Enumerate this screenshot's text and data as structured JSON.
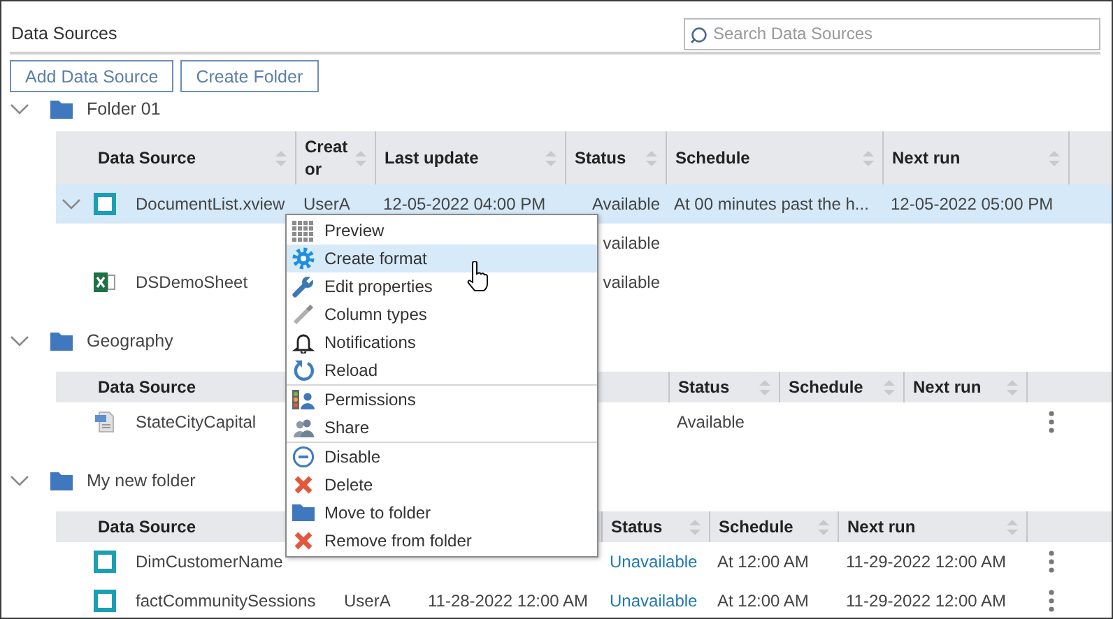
{
  "header": {
    "title": "Data Sources",
    "search": {
      "placeholder": "Search Data Sources"
    }
  },
  "toolbar": [
    "Add Data Source",
    "Create Folder"
  ],
  "folders": [
    {
      "name": "Folder 01",
      "expanded": true,
      "table": {
        "actions": false,
        "columns": [
          {
            "kind": "name",
            "label": "Data Source"
          },
          {
            "kind": "creator",
            "label": "Creator"
          },
          {
            "kind": "updated",
            "label": "Last update"
          },
          {
            "kind": "status",
            "label": "Status"
          },
          {
            "kind": "schedule",
            "label": "Schedule"
          },
          {
            "kind": "next",
            "label": "Next run"
          }
        ],
        "rows": [
          {
            "kind": "xview",
            "name": "DocumentList.xview",
            "expanded": true,
            "selected": true,
            "available": true,
            "creator": "UserA",
            "updated": "12-05-2022 04:00 PM",
            "status": "Available",
            "schedule": "At 00 minutes past the h...",
            "next": "12-05-2022 05:00 PM"
          },
          {
            "selected": false,
            "available": true,
            "status": "vailable"
          },
          {
            "kind": "excel",
            "name": "DSDemoSheet",
            "selected": false,
            "available": true,
            "status": "vailable"
          }
        ]
      }
    },
    {
      "name": "Geography",
      "expanded": true,
      "table": {
        "actions": true,
        "columns": [
          {
            "kind": "name",
            "label": "Data Source"
          },
          {
            "kind": "creator"
          },
          {
            "kind": "updated"
          },
          {
            "kind": "status",
            "label": "Status"
          },
          {
            "kind": "schedule",
            "label": "Schedule"
          },
          {
            "kind": "next",
            "label": "Next run"
          }
        ],
        "rows": [
          {
            "kind": "csv",
            "name": "StateCityCapital",
            "selected": false,
            "available": true,
            "status": "Available"
          }
        ]
      }
    },
    {
      "name": "My new folder",
      "expanded": true,
      "table": {
        "actions": true,
        "columns": [
          {
            "kind": "name",
            "label": "Data Source"
          },
          {
            "kind": "creator"
          },
          {
            "kind": "updated"
          },
          {
            "kind": "status",
            "label": "Status"
          },
          {
            "kind": "schedule",
            "label": "Schedule"
          },
          {
            "kind": "next",
            "label": "Next run"
          }
        ],
        "rows": [
          {
            "kind": "xview",
            "name": "DimCustomerName",
            "selected": false,
            "available": false,
            "status": "Unavailable",
            "schedule": "At 12:00 AM",
            "next": "11-29-2022 12:00 AM"
          },
          {
            "kind": "xview",
            "name": "factCommunitySessions",
            "selected": false,
            "available": false,
            "creator": "UserA",
            "updated": "11-28-2022 12:00 AM",
            "status": "Unavailable",
            "schedule": "At 12:00 AM",
            "next": "11-29-2022 12:00 AM"
          }
        ]
      }
    }
  ],
  "context_menu": {
    "groups": [
      [
        {
          "kind": "preview",
          "label": "Preview",
          "selected": false
        },
        {
          "kind": "format",
          "label": "Create format",
          "selected": true
        },
        {
          "kind": "edit",
          "label": "Edit properties",
          "selected": false
        },
        {
          "kind": "columns",
          "label": "Column types",
          "selected": false
        },
        {
          "kind": "notify",
          "label": "Notifications",
          "selected": false
        },
        {
          "kind": "reload",
          "label": "Reload",
          "selected": false
        }
      ],
      [
        {
          "kind": "permissions",
          "label": "Permissions",
          "selected": false
        },
        {
          "kind": "share",
          "label": "Share",
          "selected": false
        }
      ],
      [
        {
          "kind": "disable",
          "label": "Disable",
          "selected": false
        },
        {
          "kind": "delete",
          "label": "Delete",
          "selected": false
        },
        {
          "kind": "move",
          "label": "Move to folder",
          "selected": false
        },
        {
          "kind": "remove",
          "label": "Remove from folder",
          "selected": false
        }
      ]
    ]
  }
}
